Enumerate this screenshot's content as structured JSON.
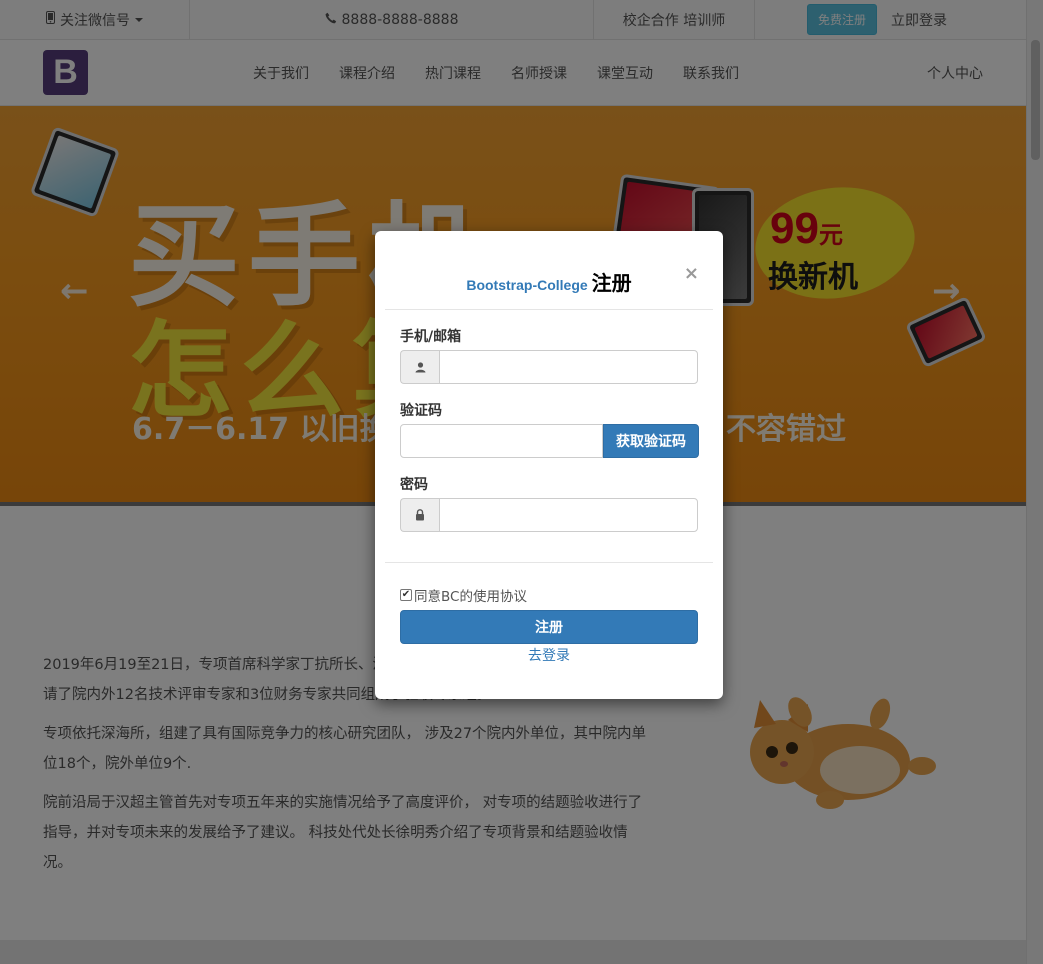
{
  "topbar": {
    "wechat_label": "关注微信号",
    "phone_number": "8888-8888-8888",
    "cooperation_label": "校企合作 培训师",
    "register_label": "免费注册",
    "login_label": "立即登录"
  },
  "nav": {
    "logo_letter": "B",
    "items": [
      "关于我们",
      "课程介绍",
      "热门课程",
      "名师授课",
      "课堂互动",
      "联系我们"
    ],
    "user_center": "个人中心"
  },
  "banner": {
    "headline_line1": "买手机",
    "headline_line2": "怎么算？",
    "dates": "6.7－6.17 以旧换",
    "tail": "不容错过",
    "promo_price": "99",
    "promo_unit": "元",
    "promo_text": "换新机",
    "prev_arrow": "←",
    "next_arrow": "→"
  },
  "article": {
    "paragraphs": [
      "2019年6月19至21日，专项首席科学家丁抗所长、温领导和专项骨干成员出席了会议。 会议邀请了院内外12名技术评审专家和3位财务专家共同组成了验收专家组。",
      "专项依托深海所，组建了具有国际竞争力的核心研究团队， 涉及27个院内外单位，其中院内单位18个，院外单位9个.",
      "院前沿局于汉超主管首先对专项五年来的实施情况给予了高度评价， 对专项的结题验收进行了指导，并对专项未来的发展给予了建议。 科技处代处长徐明秀介绍了专项背景和结题验收情况。"
    ]
  },
  "modal": {
    "brand": "Bootstrap-College",
    "title": "注册",
    "close_symbol": "×",
    "phone_email_label": "手机/邮箱",
    "phone_email_value": "",
    "code_label": "验证码",
    "code_value": "",
    "get_code_button": "获取验证码",
    "password_label": "密码",
    "password_value": "",
    "agree_checked": true,
    "agree_text": "同意BC的使用协议",
    "submit_button": "注册",
    "goto_login": "去登录"
  },
  "icons": {
    "mobile": "mobile-icon",
    "phone": "phone-icon",
    "user": "user-icon",
    "lock": "lock-icon"
  },
  "colors": {
    "primary": "#337ab7",
    "info": "#5bc0de",
    "logo": "#563d7c",
    "banner": "#f79b1f"
  }
}
